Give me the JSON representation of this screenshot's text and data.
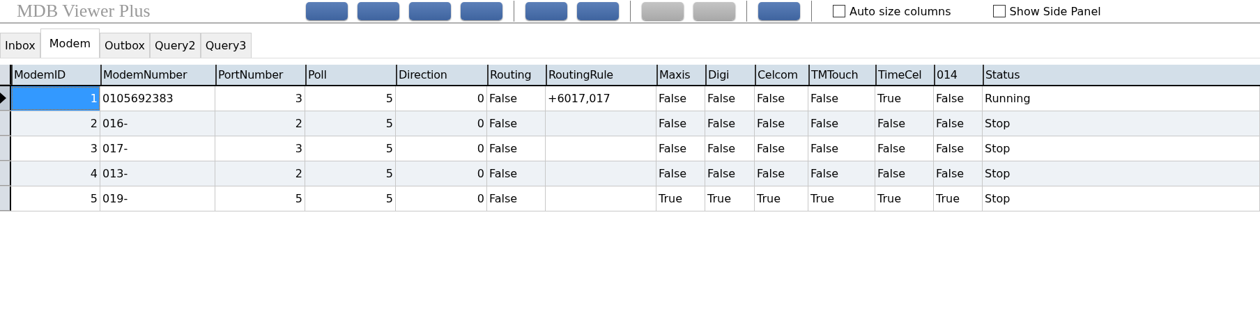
{
  "toolbar": {
    "title": "MDB Viewer Plus",
    "button_groups": [
      {
        "buttons": [
          {
            "disabled": false
          },
          {
            "disabled": false
          },
          {
            "disabled": false
          },
          {
            "disabled": false
          }
        ]
      },
      {
        "buttons": [
          {
            "disabled": false
          },
          {
            "disabled": false
          }
        ]
      },
      {
        "buttons": [
          {
            "disabled": true
          },
          {
            "disabled": true
          }
        ]
      },
      {
        "buttons": [
          {
            "disabled": false
          }
        ]
      }
    ],
    "checkboxes": [
      {
        "label": "Auto size columns",
        "checked": false
      },
      {
        "label": "Show Side Panel",
        "checked": false
      }
    ]
  },
  "tabs": [
    {
      "label": "Inbox",
      "selected": false
    },
    {
      "label": "Modem",
      "selected": true
    },
    {
      "label": "Outbox",
      "selected": false
    },
    {
      "label": "Query2",
      "selected": false
    },
    {
      "label": "Query3",
      "selected": false
    }
  ],
  "table": {
    "columns": [
      {
        "label": "ModemID",
        "kind": "number"
      },
      {
        "label": "ModemNumber",
        "kind": "text"
      },
      {
        "label": "PortNumber",
        "kind": "number"
      },
      {
        "label": "Poll",
        "kind": "number"
      },
      {
        "label": "Direction",
        "kind": "number"
      },
      {
        "label": "Routing",
        "kind": "text"
      },
      {
        "label": "RoutingRule",
        "kind": "text"
      },
      {
        "label": "Maxis",
        "kind": "text"
      },
      {
        "label": "Digi",
        "kind": "text"
      },
      {
        "label": "Celcom",
        "kind": "text"
      },
      {
        "label": "TMTouch",
        "kind": "text"
      },
      {
        "label": "TimeCel",
        "kind": "text"
      },
      {
        "label": "014",
        "kind": "text"
      },
      {
        "label": "Status",
        "kind": "text"
      }
    ],
    "rows": [
      {
        "selected": true,
        "cells": [
          "1",
          "0105692383",
          "3",
          "5",
          "0",
          "False",
          "+6017,017",
          "False",
          "False",
          "False",
          "False",
          "True",
          "False",
          "Running"
        ]
      },
      {
        "selected": false,
        "cells": [
          "2",
          "016-",
          "2",
          "5",
          "0",
          "False",
          "",
          "False",
          "False",
          "False",
          "False",
          "False",
          "False",
          "Stop"
        ]
      },
      {
        "selected": false,
        "cells": [
          "3",
          "017-",
          "3",
          "5",
          "0",
          "False",
          "",
          "False",
          "False",
          "False",
          "False",
          "False",
          "False",
          "Stop"
        ]
      },
      {
        "selected": false,
        "cells": [
          "4",
          "013-",
          "2",
          "5",
          "0",
          "False",
          "",
          "False",
          "False",
          "False",
          "False",
          "False",
          "False",
          "Stop"
        ]
      },
      {
        "selected": false,
        "cells": [
          "5",
          "019-",
          "5",
          "5",
          "0",
          "False",
          "",
          "True",
          "True",
          "True",
          "True",
          "True",
          "True",
          "Stop"
        ]
      }
    ]
  }
}
